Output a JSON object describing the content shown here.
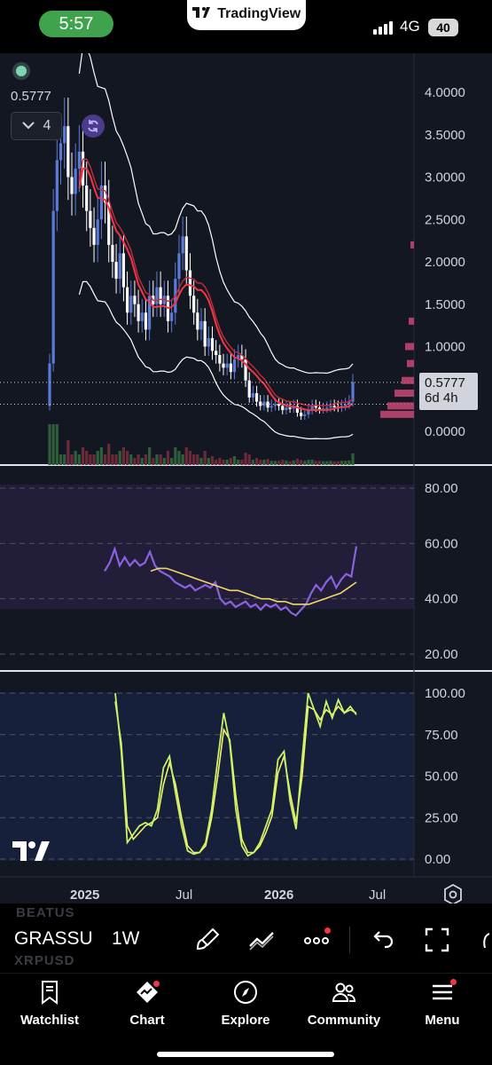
{
  "status_bar": {
    "time": "5:57",
    "app_name": "TradingView",
    "network": "4G",
    "battery": "40"
  },
  "chart": {
    "current_price": "0.5777",
    "collapse_count": "4",
    "price_tag": {
      "price": "0.5777",
      "countdown": "6d 4h"
    },
    "price_axis": [
      "4.0000",
      "3.5000",
      "3.0000",
      "2.5000",
      "2.0000",
      "1.5000",
      "1.0000",
      "0.0000"
    ],
    "rsi_axis": [
      "80.00",
      "60.00",
      "40.00",
      "20.00"
    ],
    "stoch_axis": [
      "100.00",
      "75.00",
      "50.00",
      "25.00",
      "0.00"
    ],
    "time_axis": [
      {
        "label": "2025",
        "bold": true
      },
      {
        "label": "Jul",
        "bold": false
      },
      {
        "label": "2026",
        "bold": true
      },
      {
        "label": "Jul",
        "bold": false
      }
    ],
    "colors": {
      "background": "#131722",
      "bull": "#5b7ad8",
      "bear": "#ffffff",
      "ema": "#f23645",
      "bands": "#ffffff",
      "rsi": "#8a63e0",
      "rsi_ma": "#f0d96a",
      "stoch_k": "#c7f26a",
      "stoch_d": "#f4f46a"
    }
  },
  "chart_data": [
    {
      "type": "candlestick",
      "title": "",
      "ylim": [
        -0.4,
        4.2
      ],
      "close_approx": [
        0.8,
        2.6,
        3.2,
        3.4,
        3.6,
        3.0,
        2.8,
        3.1,
        3.3,
        2.9,
        2.6,
        2.4,
        2.2,
        2.5,
        2.9,
        2.7,
        2.2,
        2.0,
        1.8,
        2.1,
        1.7,
        1.4,
        1.6,
        1.5,
        1.3,
        1.4,
        1.2,
        1.6,
        1.5,
        1.7,
        1.5,
        1.6,
        1.3,
        1.4,
        1.8,
        2.1,
        2.3,
        1.9,
        1.6,
        1.4,
        1.2,
        1.3,
        1.0,
        1.1,
        0.95,
        0.9,
        0.8,
        0.75,
        0.8,
        0.7,
        0.85,
        0.9,
        0.85,
        0.6,
        0.4,
        0.45,
        0.35,
        0.3,
        0.35,
        0.28,
        0.3,
        0.32,
        0.3,
        0.25,
        0.28,
        0.27,
        0.3,
        0.22,
        0.18,
        0.2,
        0.25,
        0.3,
        0.28,
        0.26,
        0.27,
        0.28,
        0.3,
        0.29,
        0.28,
        0.3,
        0.32,
        0.35,
        0.58
      ],
      "last": 0.5777
    },
    {
      "type": "line",
      "title": "",
      "ylim": [
        15,
        85
      ],
      "series": [
        {
          "values": [
            50,
            53,
            58,
            52,
            55,
            52,
            54,
            52,
            53,
            57,
            52,
            50,
            49,
            48,
            46,
            45,
            44,
            45,
            43,
            44,
            45,
            44,
            46,
            40,
            38,
            39,
            37,
            38,
            39,
            37,
            38,
            36,
            38,
            37,
            38,
            36,
            37,
            35,
            34,
            36,
            38,
            42,
            45,
            43,
            46,
            48,
            44,
            47,
            49,
            48,
            59
          ]
        },
        {
          "values": [
            50,
            51,
            51,
            50,
            49,
            48,
            47,
            46,
            45,
            44,
            43,
            43,
            42,
            41,
            40,
            40,
            39,
            39,
            38,
            38,
            38,
            39,
            40,
            41,
            42,
            44,
            46
          ]
        }
      ]
    },
    {
      "type": "line",
      "title": "",
      "ylim": [
        -5,
        105
      ],
      "series": [
        {
          "values": [
            100,
            65,
            10,
            15,
            20,
            22,
            20,
            30,
            55,
            62,
            40,
            20,
            5,
            3,
            4,
            10,
            30,
            60,
            88,
            70,
            30,
            8,
            2,
            4,
            10,
            20,
            30,
            60,
            65,
            35,
            18,
            60,
            100,
            90,
            80,
            95,
            85,
            96,
            88,
            92,
            87
          ]
        },
        {
          "values": [
            95,
            70,
            20,
            12,
            16,
            20,
            22,
            25,
            45,
            58,
            45,
            25,
            8,
            4,
            4,
            8,
            25,
            50,
            78,
            72,
            38,
            12,
            4,
            4,
            8,
            16,
            26,
            52,
            62,
            40,
            22,
            50,
            92,
            90,
            84,
            90,
            87,
            92,
            88,
            90,
            88
          ]
        }
      ]
    }
  ],
  "toolbar": {
    "symbol": "GRASSU",
    "interval": "1W",
    "ghost_top": "BEATUS",
    "ghost_bottom": "XRPUSD"
  },
  "nav": {
    "watchlist": "Watchlist",
    "chart": "Chart",
    "explore": "Explore",
    "community": "Community",
    "menu": "Menu"
  }
}
